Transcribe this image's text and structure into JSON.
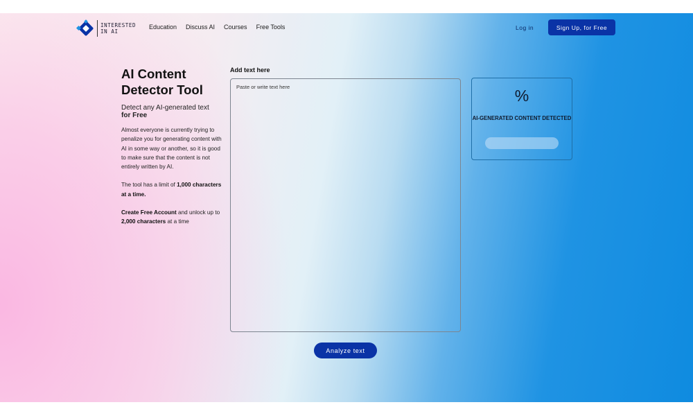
{
  "nav": {
    "logo_text_line1": "INTERESTED",
    "logo_text_line2": "IN AI",
    "links": [
      "Education",
      "Discuss AI",
      "Courses",
      "Free Tools"
    ],
    "login": "Log in",
    "signup": "Sign Up, for Free"
  },
  "intro": {
    "title": "AI Content Detector Tool",
    "subtitle": "Detect any AI-generated text",
    "subtitle_bold": "for Free",
    "description": "Almost everyone is currently trying to penalize you for generating content with AI in some way or another, so it is good to make sure that the content is not entirely written by AI.",
    "limit_prefix": "The tool has a limit of ",
    "limit_bold": "1,000 characters at a time.",
    "account_bold": "Create Free Account",
    "account_mid": " and unlock up to ",
    "account_bold2": "2,000 characters",
    "account_suffix": " at a time"
  },
  "editor": {
    "label": "Add text here",
    "placeholder": "Paste or write text here",
    "value": ""
  },
  "result": {
    "percent_symbol": "%",
    "label": "AI-GENERATED CONTENT DETECTED"
  },
  "actions": {
    "analyze": "Analyze text"
  },
  "colors": {
    "primary": "#0a33a6",
    "border": "#1f6fa8"
  }
}
